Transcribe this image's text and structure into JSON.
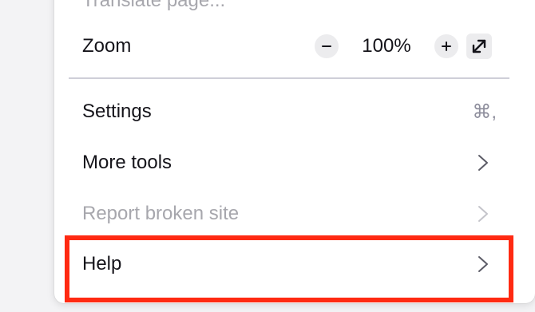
{
  "menu": {
    "partial_item_label": "Translate page...",
    "zoom": {
      "label": "Zoom",
      "value": "100%",
      "decrease_symbol": "−",
      "increase_symbol": "+"
    },
    "items": [
      {
        "label": "Settings",
        "shortcut": "⌘,"
      },
      {
        "label": "More tools"
      },
      {
        "label": "Report broken site",
        "disabled": true
      },
      {
        "label": "Help"
      }
    ]
  },
  "annotation": {
    "highlight_color": "#ff2a12",
    "highlighted_item": "Help"
  }
}
